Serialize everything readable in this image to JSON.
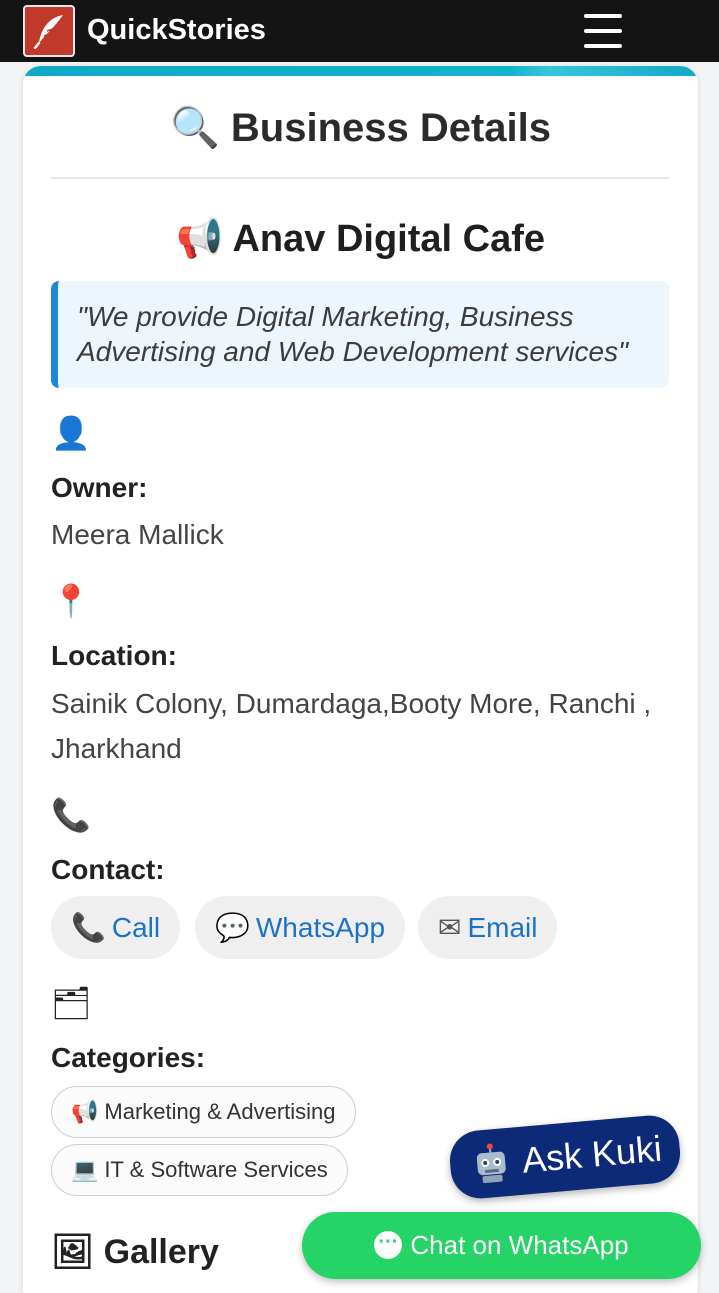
{
  "header": {
    "brand": "QuickStories",
    "logo_icon": "feather-icon",
    "menu_icon": "hamburger-menu-icon"
  },
  "page": {
    "title_icon": "🔍",
    "title": "Business Details"
  },
  "business": {
    "name_icon": "📢",
    "name": "Anav Digital Cafe",
    "tagline": "\"We provide Digital Marketing, Business Advertising and Web Development services\""
  },
  "owner": {
    "icon": "👤",
    "label": "Owner:",
    "value": "Meera Mallick"
  },
  "location": {
    "icon": "📍",
    "label": "Location:",
    "value": "Sainik Colony, Dumardaga,Booty More, Ranchi , Jharkhand"
  },
  "contact": {
    "icon": "📞",
    "label": "Contact:",
    "buttons": [
      {
        "icon": "📞",
        "label": "Call"
      },
      {
        "icon": "💬",
        "label": "WhatsApp"
      },
      {
        "icon": "✉",
        "label": "Email"
      }
    ]
  },
  "categories": {
    "icon": "🗂",
    "label": "Categories:",
    "items": [
      {
        "icon": "📢",
        "label": "Marketing & Advertising"
      },
      {
        "icon": "💻",
        "label": "IT & Software Services"
      }
    ]
  },
  "gallery": {
    "icon": "🖼",
    "label": "Gallery"
  },
  "floating": {
    "ask_label": "Ask Kuki",
    "whatsapp_label": "Chat on WhatsApp"
  },
  "colors": {
    "header_bg": "#141414",
    "accent_bar": "#11a8c6",
    "link_blue": "#1a73c6",
    "quote_border": "#1e88d8",
    "ask_bg": "#0d2a78",
    "whatsapp_green": "#25d366"
  }
}
